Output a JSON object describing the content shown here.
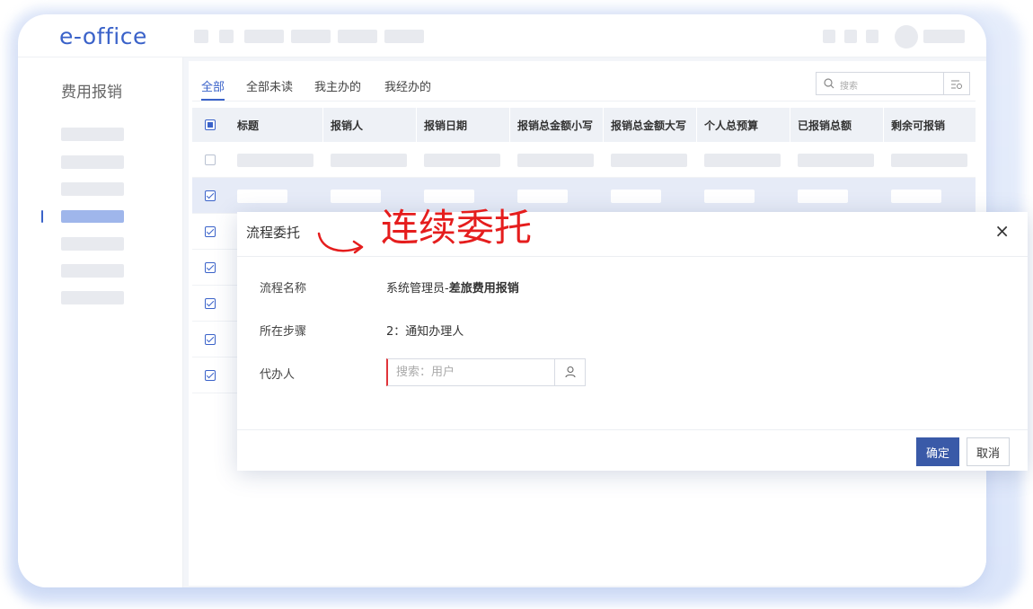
{
  "app": {
    "logo": "e-office"
  },
  "sidebar": {
    "title": "费用报销"
  },
  "tabs": [
    {
      "label": "全部",
      "active": true
    },
    {
      "label": "全部未读",
      "active": false
    },
    {
      "label": "我主办的",
      "active": false
    },
    {
      "label": "我经办的",
      "active": false
    }
  ],
  "search": {
    "placeholder": "搜索"
  },
  "table": {
    "columns": [
      "标题",
      "报销人",
      "报销日期",
      "报销总金额小写",
      "报销总金额大写",
      "个人总预算",
      "已报销总额",
      "剩余可报销"
    ]
  },
  "annotation": "连续委托",
  "dialog": {
    "title": "流程委托",
    "close": "×",
    "fields": {
      "name_label": "流程名称",
      "name_prefix": "系统管理员-",
      "name_value": "差旅费用报销",
      "step_label": "所在步骤",
      "step_value": "2：通知办理人",
      "agent_label": "代办人",
      "agent_placeholder": "搜索：用户"
    },
    "ok": "确定",
    "cancel": "取消"
  },
  "colors": {
    "accent": "#3a62c9",
    "annotation": "#e51d1d",
    "ok_button": "#3a5aa8"
  }
}
